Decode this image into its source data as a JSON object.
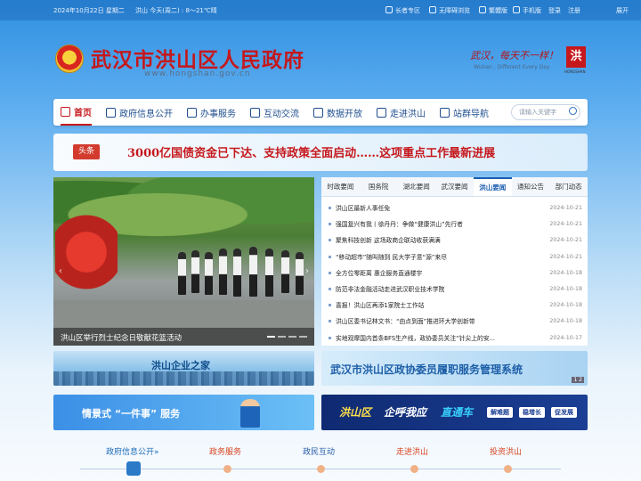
{
  "topbar": {
    "date": "2024年10月22日 星期二",
    "weather": "洪山  今天(周二) : 8～21℃晴",
    "links": [
      "长者专区",
      "无障碍浏览",
      "繁體版",
      "手机版",
      "登录",
      "注册"
    ],
    "expand": "展开"
  },
  "header": {
    "title": "武汉市洪山区人民政府",
    "url": "www.hongshan.gov.cn",
    "slogan": "武汉，每天不一样！",
    "slogan_en": "Wuhan , Different Every Day",
    "seal_char": "洪",
    "seal_text": "HONGSHAN"
  },
  "nav": {
    "items": [
      {
        "label": "首页",
        "icon": "home-icon"
      },
      {
        "label": "政府信息公开",
        "icon": "document-icon"
      },
      {
        "label": "办事服务",
        "icon": "service-icon"
      },
      {
        "label": "互动交流",
        "icon": "chat-icon"
      },
      {
        "label": "数据开放",
        "icon": "chart-icon"
      },
      {
        "label": "走进洪山",
        "icon": "building-icon"
      },
      {
        "label": "站群导航",
        "icon": "network-icon"
      }
    ],
    "search_placeholder": "请输入关键字"
  },
  "headline": {
    "tag": "头条",
    "text": "3000亿国债资金已下达、支持政策全面启动……这项重点工作最新进展"
  },
  "photo": {
    "caption": "洪山区举行烈士纪念日敬献花篮活动",
    "prev": "‹",
    "next": "›"
  },
  "news": {
    "tabs": [
      "时政要闻",
      "国务院",
      "湖北要闻",
      "武汉要闻",
      "洪山要闻",
      "通知公告",
      "部门动态"
    ],
    "active_tab": 4,
    "items": [
      {
        "title": "洪山区最新人事任免",
        "date": "2024-10-21"
      },
      {
        "title": "强国复兴有我丨徐丹丹：争做“健康洪山”先行者",
        "date": "2024-10-21"
      },
      {
        "title": "聚焦科技创新 这场政商企联动收获满满",
        "date": "2024-10-21"
      },
      {
        "title": "“移动超市”随叫随到 民大学子意“源”来尽",
        "date": "2024-10-21"
      },
      {
        "title": "全方位零距离 惠企服务直通楼宇",
        "date": "2024-10-18"
      },
      {
        "title": "防范非法金融活动走进武汉职业技术学院",
        "date": "2024-10-18"
      },
      {
        "title": "喜报！洪山区再添1家院士工作站",
        "date": "2024-10-18"
      },
      {
        "title": "洪山区委书记林文书：“由点到面”推进环大学创新带",
        "date": "2024-10-18"
      },
      {
        "title": "实地观摩国内首条BFS生产线，政协委员关注“针尖上的安...",
        "date": "2024-10-17"
      }
    ]
  },
  "banners": {
    "enterprise": "洪山企业之家",
    "cppcc": "武汉市洪山区政协委员履职服务管理系统",
    "cppcc_page": "1 2",
    "one_thing": "情景式 “一件事” 服务",
    "call_a": "洪山区",
    "call_b": "企呼我应",
    "call_c": "直通车",
    "pills": [
      "解难题",
      "稳增长",
      "促发展"
    ]
  },
  "bottom_nav": {
    "items": [
      "政府信息公开",
      "政务服务",
      "政民互动",
      "走进洪山",
      "投资洪山"
    ],
    "colors": [
      "#1d6ab8",
      "#d8441e",
      "#2a5fa8",
      "#d8441e",
      "#d8441e"
    ]
  }
}
